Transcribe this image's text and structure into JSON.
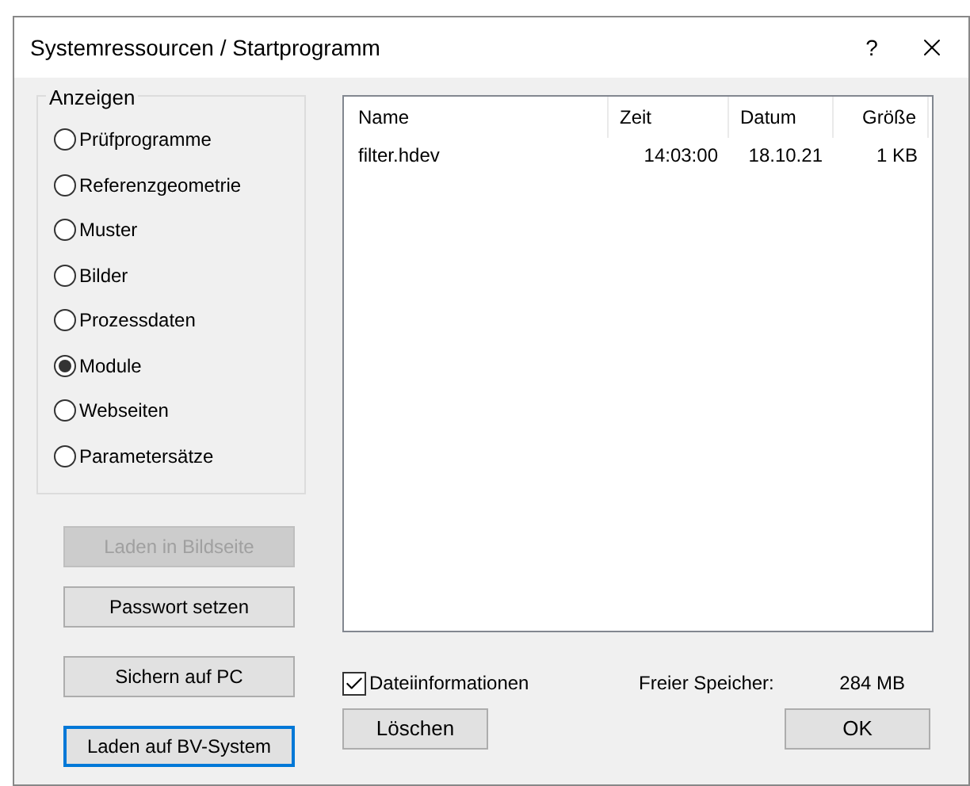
{
  "window": {
    "title": "Systemressourcen / Startprogramm",
    "help": "?"
  },
  "display_group": {
    "title": "Anzeigen",
    "options": [
      {
        "label": "Prüfprogramme",
        "selected": false
      },
      {
        "label": "Referenzgeometrie",
        "selected": false
      },
      {
        "label": "Muster",
        "selected": false
      },
      {
        "label": "Bilder",
        "selected": false
      },
      {
        "label": "Prozessdaten",
        "selected": false
      },
      {
        "label": "Module",
        "selected": true
      },
      {
        "label": "Webseiten",
        "selected": false
      },
      {
        "label": "Parametersätze",
        "selected": false
      }
    ]
  },
  "file_list": {
    "columns": [
      "Name",
      "Zeit",
      "Datum",
      "Größe"
    ],
    "rows": [
      [
        "filter.hdev",
        "14:03:00",
        "18.10.21",
        "1 KB"
      ]
    ]
  },
  "side_buttons": [
    {
      "label": "Laden in Bildseite",
      "disabled": true,
      "focused": false
    },
    {
      "label": "Passwort setzen",
      "disabled": false,
      "focused": false
    },
    {
      "label": "Sichern auf PC",
      "disabled": false,
      "focused": false
    },
    {
      "label": "Laden auf BV-System",
      "disabled": false,
      "focused": true
    }
  ],
  "file_info": {
    "label": "Dateiinformationen",
    "checked": true
  },
  "free_memory": {
    "label": "Freier Speicher:",
    "value": "284 MB"
  },
  "delete_button": "Löschen",
  "ok_button": "OK"
}
